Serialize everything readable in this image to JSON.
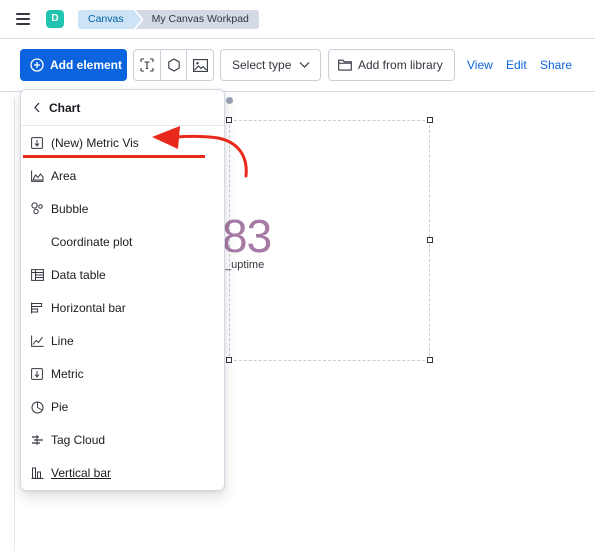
{
  "header": {
    "space_initial": "D",
    "breadcrumbs": [
      "Canvas",
      "My Canvas Workpad"
    ]
  },
  "toolbar": {
    "add_element_label": "Add element",
    "select_type_label": "Select type",
    "add_from_library_label": "Add from library",
    "view_label": "View",
    "edit_label": "Edit",
    "share_label": "Share"
  },
  "menu": {
    "title": "Chart",
    "items": [
      {
        "label": "(New) Metric Vis",
        "icon": "metric-icon"
      },
      {
        "label": "Area",
        "icon": "area-chart-icon"
      },
      {
        "label": "Bubble",
        "icon": "bubble-chart-icon"
      },
      {
        "label": "Coordinate plot",
        "icon": ""
      },
      {
        "label": "Data table",
        "icon": "table-icon"
      },
      {
        "label": "Horizontal bar",
        "icon": "horizontal-bar-icon"
      },
      {
        "label": "Line",
        "icon": "line-chart-icon"
      },
      {
        "label": "Metric",
        "icon": "metric-icon"
      },
      {
        "label": "Pie",
        "icon": "pie-chart-icon"
      },
      {
        "label": "Tag Cloud",
        "icon": "tag-cloud-icon"
      },
      {
        "label": "Vertical bar",
        "icon": "vertical-bar-icon"
      }
    ]
  },
  "workpad": {
    "metric_value": "83",
    "metric_label": "t_uptime"
  },
  "colors": {
    "primary": "#0b64dd",
    "metric_value": "#a67aa5",
    "annotation_arrow": "#e8291c",
    "space_avatar": "#20c4b0"
  }
}
